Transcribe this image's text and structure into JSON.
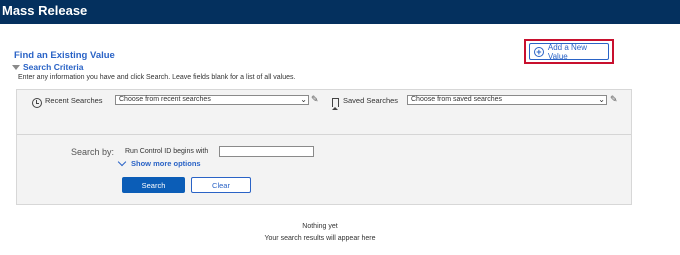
{
  "header": {
    "title": "Mass Release"
  },
  "add_new": {
    "label": "Add a New Value",
    "highlight_color": "#c8102e"
  },
  "find": {
    "title": "Find an Existing Value",
    "criteria_label": "Search Criteria",
    "instructions": "Enter any information you have and click Search. Leave fields blank for a list of all values."
  },
  "recent": {
    "label": "Recent Searches",
    "placeholder": "Choose from recent searches"
  },
  "saved": {
    "label": "Saved Searches",
    "placeholder": "Choose from saved searches"
  },
  "search_by": {
    "label": "Search by:",
    "field_label": "Run Control ID",
    "operator": "begins with",
    "value": "",
    "more_options": "Show more options"
  },
  "buttons": {
    "search": "Search",
    "clear": "Clear"
  },
  "results": {
    "empty_title": "Nothing yet",
    "empty_message": "Your search results will appear here"
  },
  "colors": {
    "titlebar": "#04305e",
    "accent": "#2a63c6",
    "primary_button": "#0b5db7"
  },
  "icons": [
    "add-circle-icon",
    "history-icon",
    "pencil-icon",
    "bookmark-icon",
    "chevron-down-icon",
    "caret-down-icon"
  ]
}
